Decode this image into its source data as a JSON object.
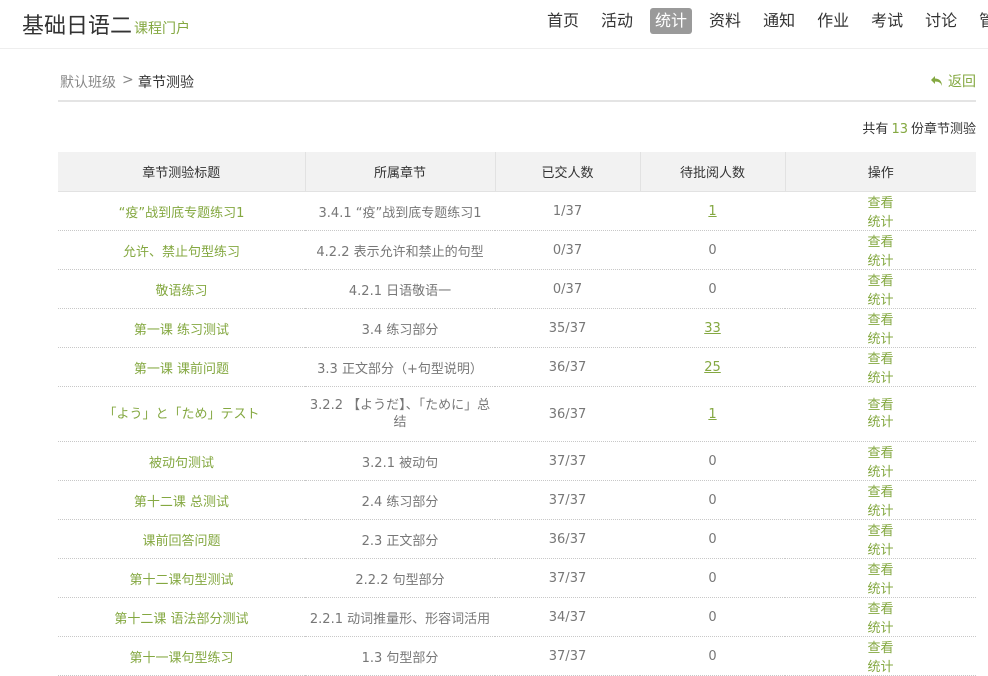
{
  "header": {
    "course_title": "基础日语二",
    "course_subtitle": "课程门户",
    "nav": [
      "首页",
      "活动",
      "统计",
      "资料",
      "通知",
      "作业",
      "考试",
      "讨论",
      "管理"
    ],
    "active_nav": "统计"
  },
  "breadcrumb": {
    "root": "默认班级",
    "separator": ">",
    "current": "章节测验",
    "back_label": "返回"
  },
  "summary": {
    "prefix": "共有",
    "count": "13",
    "suffix": "份章节测验"
  },
  "table": {
    "columns": [
      "章节测验标题",
      "所属章节",
      "已交人数",
      "待批阅人数",
      "操作"
    ],
    "view_label": "查看",
    "stat_label": "统计",
    "rows": [
      {
        "title": "“疫”战到底专题练习1",
        "chapter": "3.4.1 “疫”战到底专题练习1",
        "submitted": "1/37",
        "pending": "1",
        "pending_link": true
      },
      {
        "title": "允许、禁止句型练习",
        "chapter": "4.2.2 表示允许和禁止的句型",
        "submitted": "0/37",
        "pending": "0",
        "pending_link": false
      },
      {
        "title": "敬语练习",
        "chapter": "4.2.1 日语敬语一",
        "submitted": "0/37",
        "pending": "0",
        "pending_link": false
      },
      {
        "title": "第一课 练习测试",
        "chapter": "3.4 练习部分",
        "submitted": "35/37",
        "pending": "33",
        "pending_link": true
      },
      {
        "title": "第一课 课前问题",
        "chapter": "3.3 正文部分（+句型说明）",
        "submitted": "36/37",
        "pending": "25",
        "pending_link": true
      },
      {
        "title": "「よう」と「ため」テスト",
        "chapter": "3.2.2 【ようだ】、「ために」总结",
        "submitted": "36/37",
        "pending": "1",
        "pending_link": true
      },
      {
        "title": "被动句测试",
        "chapter": "3.2.1 被动句",
        "submitted": "37/37",
        "pending": "0",
        "pending_link": false
      },
      {
        "title": "第十二课 总测试",
        "chapter": "2.4 练习部分",
        "submitted": "37/37",
        "pending": "0",
        "pending_link": false
      },
      {
        "title": "课前回答问题",
        "chapter": "2.3 正文部分",
        "submitted": "36/37",
        "pending": "0",
        "pending_link": false
      },
      {
        "title": "第十二课句型测试",
        "chapter": "2.2.2 句型部分",
        "submitted": "37/37",
        "pending": "0",
        "pending_link": false
      },
      {
        "title": "第十二课 语法部分测试",
        "chapter": "2.2.1 动词推量形、形容词活用",
        "submitted": "34/37",
        "pending": "0",
        "pending_link": false
      },
      {
        "title": "第十一课句型练习",
        "chapter": "1.3 句型部分",
        "submitted": "37/37",
        "pending": "0",
        "pending_link": false
      }
    ]
  },
  "colors": {
    "accent": "#84a841",
    "active_nav_bg": "#9a9a9a",
    "header_row_bg": "#f2f2f2"
  }
}
